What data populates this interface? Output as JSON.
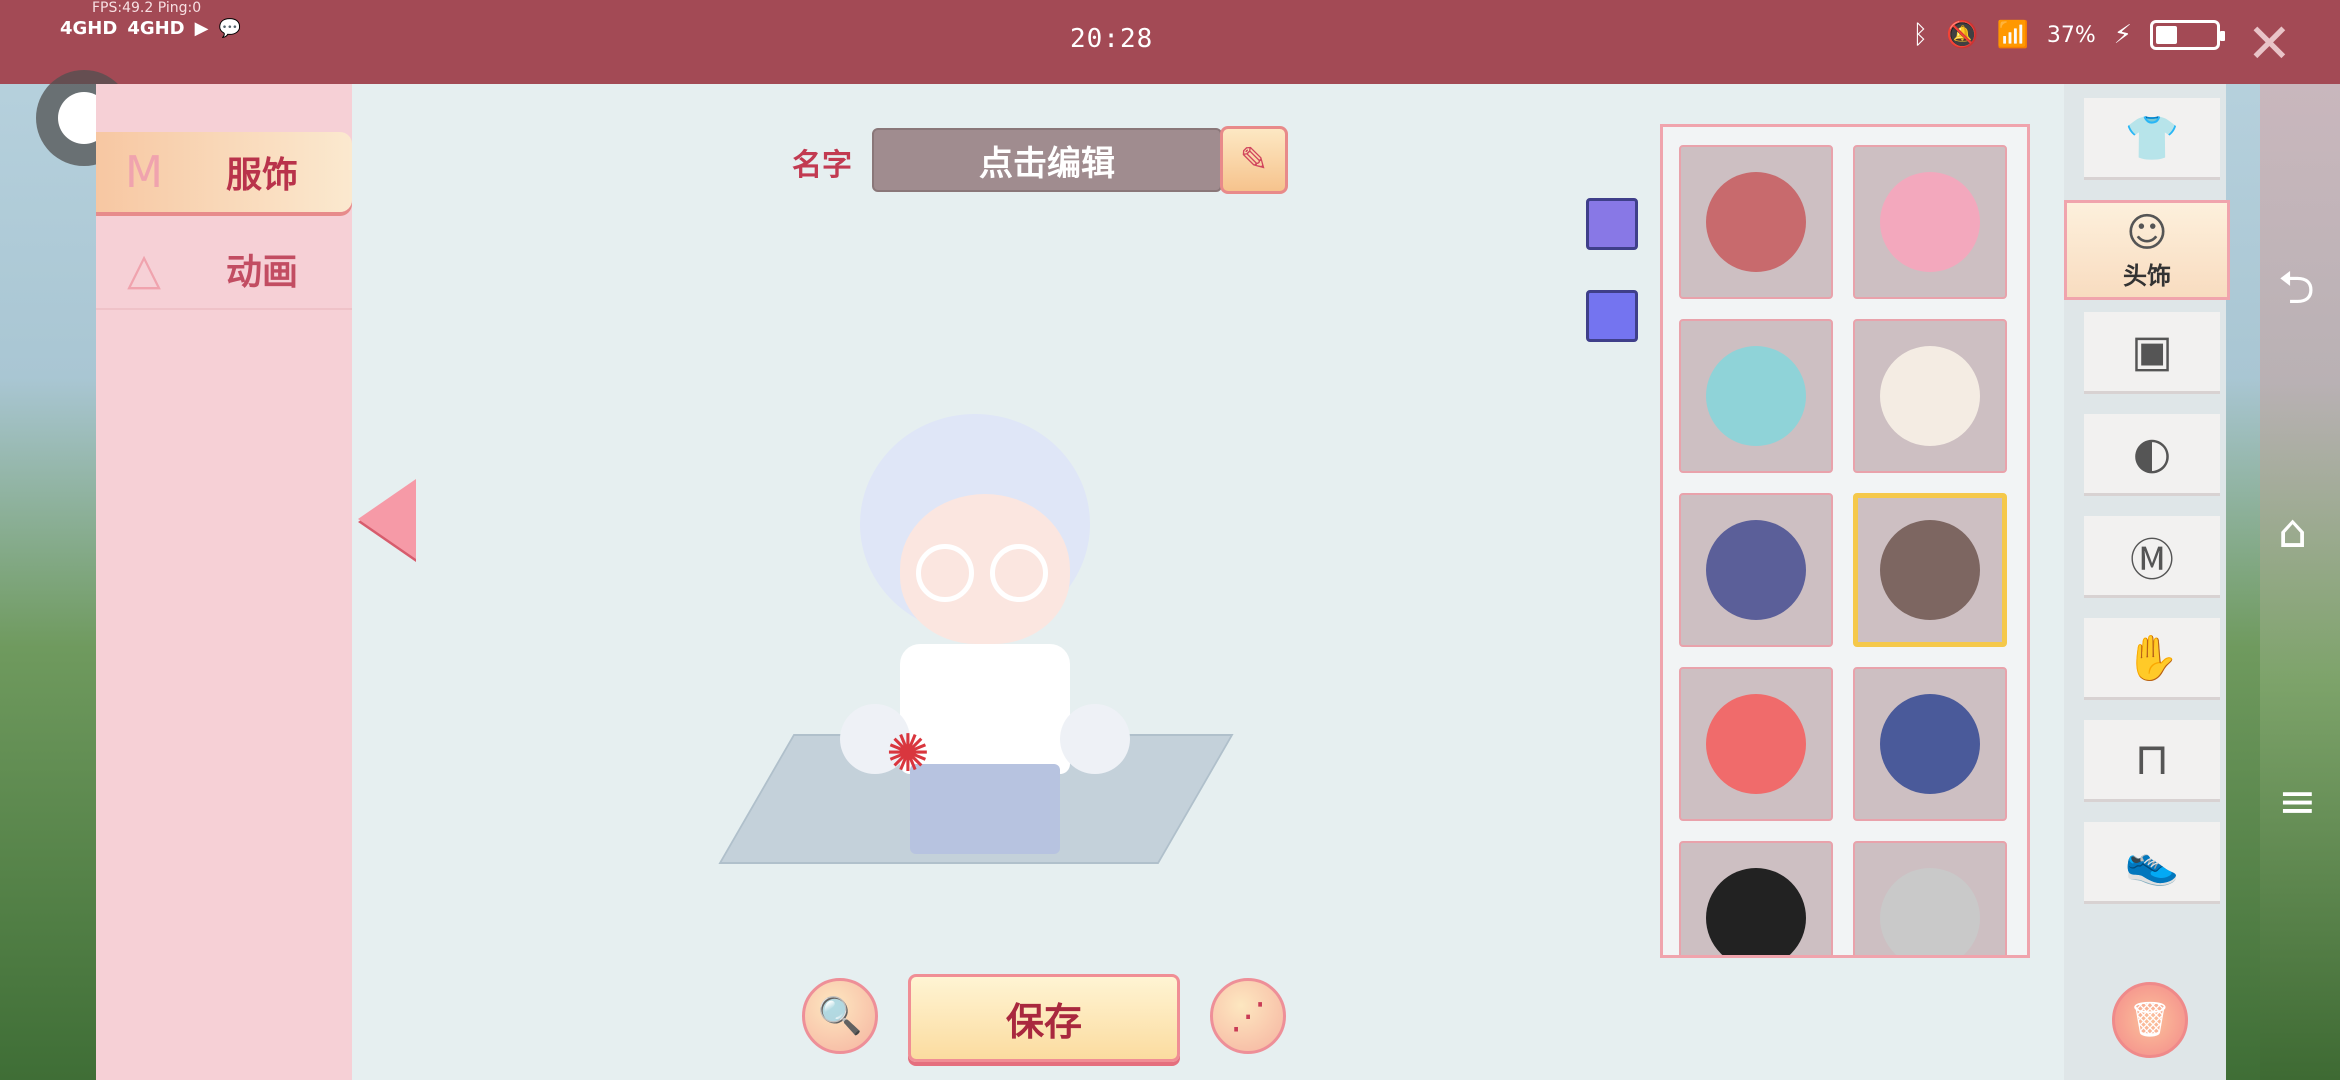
{
  "status_bar": {
    "fps_text": "FPS:49.2  Ping:0",
    "network_1": "4GHD",
    "network_2": "4GHD",
    "clock": "20:28",
    "battery_percent": "37%",
    "battery_level": 0.37
  },
  "left_menu": {
    "items": [
      {
        "label": "服饰",
        "icon": "shirt-m-icon",
        "active": true
      },
      {
        "label": "动画",
        "icon": "triangle-icon",
        "active": false
      }
    ]
  },
  "name": {
    "label": "名字",
    "value": "点击编辑"
  },
  "swatches": [
    "#8878e6",
    "#7474f0"
  ],
  "grid": {
    "items": [
      {
        "name": "pink-twin-bun-hair",
        "color": "#c86a6d"
      },
      {
        "name": "pink-sunhat-hair",
        "color": "#f3a8bd"
      },
      {
        "name": "cake-crown-hair",
        "color": "#8fd3d8"
      },
      {
        "name": "cat-hood",
        "color": "#f4ece3"
      },
      {
        "name": "zigzag-beanie",
        "color": "#5b5f99"
      },
      {
        "name": "brown-braid-hair",
        "color": "#7d6661",
        "selected": true
      },
      {
        "name": "tomato-hair",
        "color": "#f06b6b"
      },
      {
        "name": "straw-hat-blue-hair",
        "color": "#4a5a9a"
      },
      {
        "name": "bunny-ears-hair",
        "color": "#222222"
      },
      {
        "name": "grey-cat-ears-hair",
        "color": "#c9c9c9"
      }
    ]
  },
  "bottom": {
    "save_label": "保存"
  },
  "categories": {
    "items": [
      {
        "icon": "outfit-icon"
      },
      {
        "icon": "head-icon",
        "label": "头饰",
        "active": true
      },
      {
        "icon": "face-icon"
      },
      {
        "icon": "mask-icon"
      },
      {
        "icon": "tshirt-icon"
      },
      {
        "icon": "gloves-icon"
      },
      {
        "icon": "pants-icon"
      },
      {
        "icon": "shoes-icon"
      }
    ]
  },
  "colors": {
    "status_bar": "#a34a55",
    "accent": "#c23a51",
    "panel": "#e6eff0",
    "menu": "#f6d0d6"
  }
}
